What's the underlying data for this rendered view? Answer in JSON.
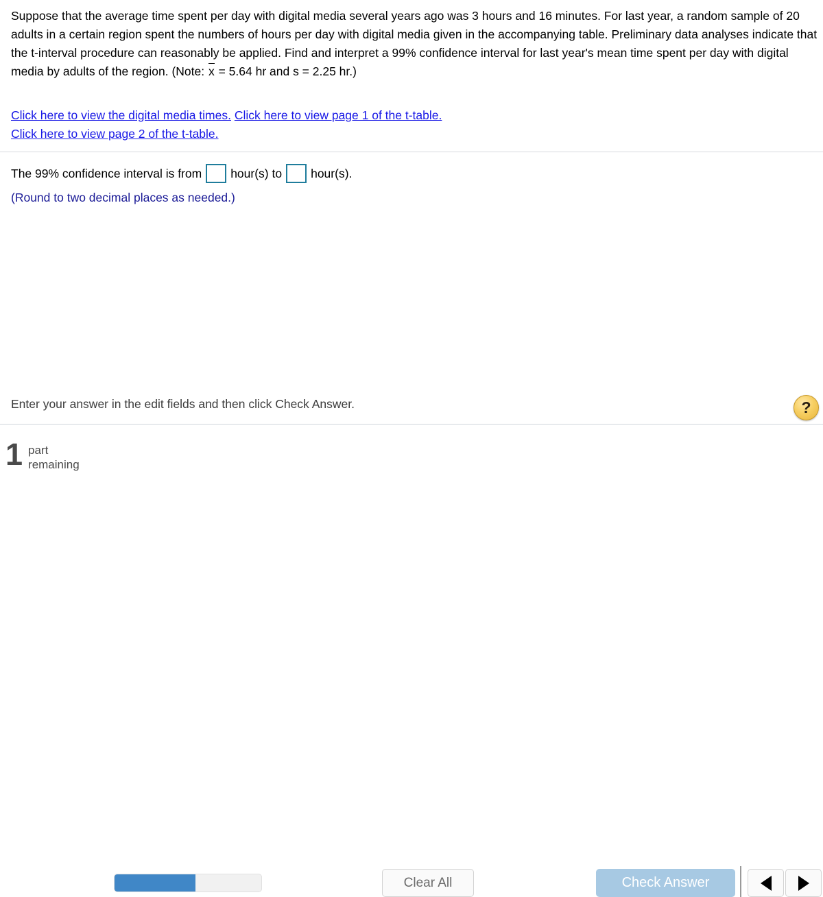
{
  "problem": {
    "sentence_1": "Suppose that the average time spent per day with digital media several years ago was 3 hours and 16 minutes. For last year, a random sample of 20 adults in a certain region spent the numbers of hours per day with digital media given in the accompanying table. Preliminary data analyses indicate that the t-interval procedure can reasonably be applied. Find and interpret a 99% confidence interval for last year's mean time spent per day with digital media by adults of the region. (Note: ",
    "note_prefix": "x",
    "note_suffix": " = 5.64 hr and s = 2.25 hr.)",
    "links": [
      {
        "label": "Click here to view the digital media times."
      },
      {
        "label": "Click here to view page 1 of the t-table."
      },
      {
        "label": "Click here to view page 2 of the t-table."
      }
    ]
  },
  "answer": {
    "prefix": "The 99% confidence interval is from",
    "middle": "hour(s) to",
    "suffix": "hour(s).",
    "lower_value": "",
    "upper_value": "",
    "rounding_note": "(Round to two decimal places as needed.)"
  },
  "status": {
    "message": "Enter your answer in the edit fields and then click Check Answer.",
    "help_label": "?"
  },
  "toolbar": {
    "parts_count": "1",
    "parts_label_line1": "part",
    "parts_label_line2": "remaining",
    "progress_percent": 55,
    "clear_all_label": "Clear All",
    "check_answer_label": "Check Answer",
    "prev_label": "previous-arrow",
    "next_label": "next-arrow"
  },
  "colors": {
    "link": "#1919e6",
    "input_border": "#1f7d9c",
    "note_text": "#1a1a96",
    "progress_fill": "#4087c7",
    "check_button": "#a7c9e3",
    "help_button": "#f0c24f"
  }
}
